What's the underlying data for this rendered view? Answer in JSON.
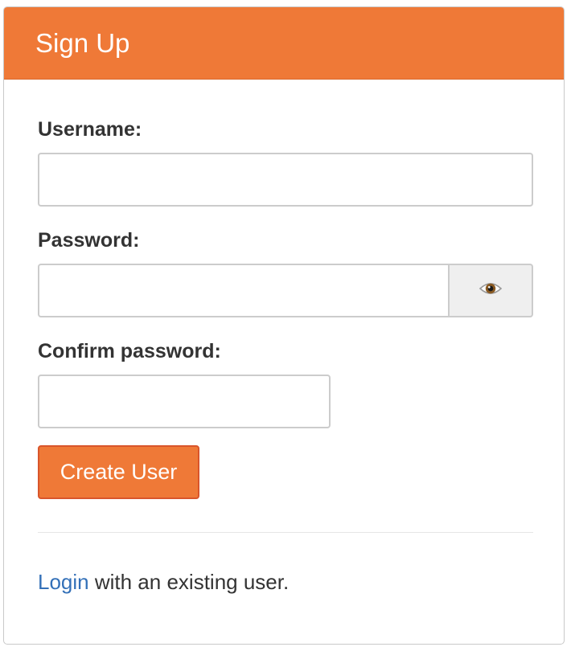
{
  "header": {
    "title": "Sign Up"
  },
  "form": {
    "username": {
      "label": "Username:",
      "value": ""
    },
    "password": {
      "label": "Password:",
      "value": "",
      "toggle_icon": "eye-icon"
    },
    "confirm_password": {
      "label": "Confirm password:",
      "value": ""
    },
    "submit_label": "Create User"
  },
  "footer": {
    "login_link": "Login",
    "login_text": " with an existing user."
  },
  "colors": {
    "accent": "#ef7937",
    "link": "#3370b8"
  }
}
